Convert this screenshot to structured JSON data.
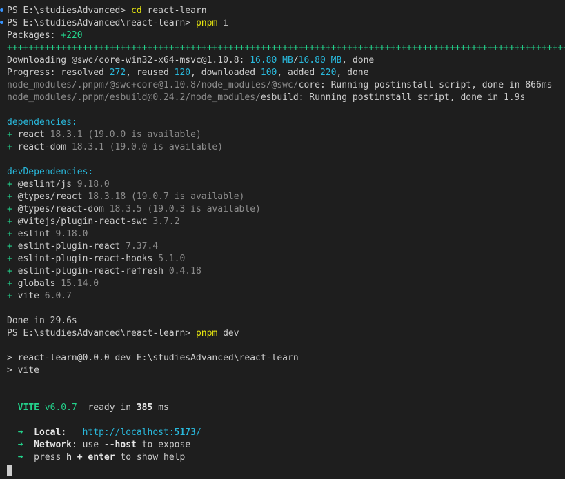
{
  "terminal": {
    "background": "#1e1e1e",
    "colors": {
      "default": "#cccccc",
      "command": "#e5e510",
      "info": "#29b8db",
      "success": "#23d18b",
      "dim": "#8d8d8d",
      "command_decoration": "#3794ff"
    },
    "lines": [
      [
        {
          "t": "PS E:\\studiesAdvanced> ",
          "c": "default"
        },
        {
          "t": "cd",
          "c": "yellow"
        },
        {
          "t": " react-learn",
          "c": "default"
        }
      ],
      [
        {
          "t": "PS E:\\studiesAdvanced\\react-learn> ",
          "c": "default"
        },
        {
          "t": "pnpm",
          "c": "yellow"
        },
        {
          "t": " i",
          "c": "default"
        }
      ],
      [
        {
          "t": "Packages: ",
          "c": "default"
        },
        {
          "t": "+220",
          "c": "green"
        }
      ],
      [
        {
          "t": "++++++++++++++++++++++++++++++++++++++++++++++++++++++++++++++++++++++++++++++++++++++++++++++++++++++++",
          "c": "green"
        }
      ],
      [
        {
          "t": "Downloading @swc/core-win32-x64-msvc@1.10.8: ",
          "c": "default"
        },
        {
          "t": "16.80 MB",
          "c": "cyan"
        },
        {
          "t": "/",
          "c": "default"
        },
        {
          "t": "16.80 MB",
          "c": "cyan"
        },
        {
          "t": ", done",
          "c": "default"
        }
      ],
      [
        {
          "t": "Progress: resolved ",
          "c": "default"
        },
        {
          "t": "272",
          "c": "cyan"
        },
        {
          "t": ", reused ",
          "c": "default"
        },
        {
          "t": "120",
          "c": "cyan"
        },
        {
          "t": ", downloaded ",
          "c": "default"
        },
        {
          "t": "100",
          "c": "cyan"
        },
        {
          "t": ", added ",
          "c": "default"
        },
        {
          "t": "220",
          "c": "cyan"
        },
        {
          "t": ", done",
          "c": "default"
        }
      ],
      [
        {
          "t": "node_modules/.pnpm/@swc+core@1.10.8/node_modules/@swc/",
          "c": "gray"
        },
        {
          "t": "core: Running postinstall script, done in 866ms",
          "c": "default"
        }
      ],
      [
        {
          "t": "node_modules/.pnpm/esbuild@0.24.2/node_modules/",
          "c": "gray"
        },
        {
          "t": "esbuild: Running postinstall script, done in 1.9s",
          "c": "default"
        }
      ],
      [],
      [
        {
          "t": "dependencies:",
          "c": "cyan"
        }
      ],
      [
        {
          "t": "+ ",
          "c": "green"
        },
        {
          "t": "react ",
          "c": "default"
        },
        {
          "t": "18.3.1 (19.0.0 is available)",
          "c": "gray"
        }
      ],
      [
        {
          "t": "+ ",
          "c": "green"
        },
        {
          "t": "react-dom ",
          "c": "default"
        },
        {
          "t": "18.3.1 (19.0.0 is available)",
          "c": "gray"
        }
      ],
      [],
      [
        {
          "t": "devDependencies:",
          "c": "cyan"
        }
      ],
      [
        {
          "t": "+ ",
          "c": "green"
        },
        {
          "t": "@eslint/js ",
          "c": "default"
        },
        {
          "t": "9.18.0",
          "c": "gray"
        }
      ],
      [
        {
          "t": "+ ",
          "c": "green"
        },
        {
          "t": "@types/react ",
          "c": "default"
        },
        {
          "t": "18.3.18 (19.0.7 is available)",
          "c": "gray"
        }
      ],
      [
        {
          "t": "+ ",
          "c": "green"
        },
        {
          "t": "@types/react-dom ",
          "c": "default"
        },
        {
          "t": "18.3.5 (19.0.3 is available)",
          "c": "gray"
        }
      ],
      [
        {
          "t": "+ ",
          "c": "green"
        },
        {
          "t": "@vitejs/plugin-react-swc ",
          "c": "default"
        },
        {
          "t": "3.7.2",
          "c": "gray"
        }
      ],
      [
        {
          "t": "+ ",
          "c": "green"
        },
        {
          "t": "eslint ",
          "c": "default"
        },
        {
          "t": "9.18.0",
          "c": "gray"
        }
      ],
      [
        {
          "t": "+ ",
          "c": "green"
        },
        {
          "t": "eslint-plugin-react ",
          "c": "default"
        },
        {
          "t": "7.37.4",
          "c": "gray"
        }
      ],
      [
        {
          "t": "+ ",
          "c": "green"
        },
        {
          "t": "eslint-plugin-react-hooks ",
          "c": "default"
        },
        {
          "t": "5.1.0",
          "c": "gray"
        }
      ],
      [
        {
          "t": "+ ",
          "c": "green"
        },
        {
          "t": "eslint-plugin-react-refresh ",
          "c": "default"
        },
        {
          "t": "0.4.18",
          "c": "gray"
        }
      ],
      [
        {
          "t": "+ ",
          "c": "green"
        },
        {
          "t": "globals ",
          "c": "default"
        },
        {
          "t": "15.14.0",
          "c": "gray"
        }
      ],
      [
        {
          "t": "+ ",
          "c": "green"
        },
        {
          "t": "vite ",
          "c": "default"
        },
        {
          "t": "6.0.7",
          "c": "gray"
        }
      ],
      [],
      [
        {
          "t": "Done in 29.6s",
          "c": "default"
        }
      ],
      [
        {
          "t": "PS E:\\studiesAdvanced\\react-learn> ",
          "c": "default"
        },
        {
          "t": "pnpm",
          "c": "yellow"
        },
        {
          "t": " dev",
          "c": "default"
        }
      ],
      [],
      [
        {
          "t": "> react-learn@0.0.0 dev E:\\studiesAdvanced\\react-learn",
          "c": "default"
        }
      ],
      [
        {
          "t": "> vite",
          "c": "default"
        }
      ],
      [],
      [],
      [
        {
          "t": "  ",
          "c": "default"
        },
        {
          "t": "VITE",
          "c": "green",
          "b": true
        },
        {
          "t": " v6.0.7",
          "c": "green"
        },
        {
          "t": "  ready in ",
          "c": "default"
        },
        {
          "t": "385",
          "c": "boldwhite"
        },
        {
          "t": " ms",
          "c": "default"
        }
      ],
      [],
      [
        {
          "t": "  ",
          "c": "default"
        },
        {
          "t": "➜",
          "c": "green"
        },
        {
          "t": "  ",
          "c": "default"
        },
        {
          "t": "Local:",
          "c": "boldwhite"
        },
        {
          "t": "   ",
          "c": "default"
        },
        {
          "t": "http://localhost:",
          "c": "cyan"
        },
        {
          "t": "5173",
          "c": "cyan",
          "b": true
        },
        {
          "t": "/",
          "c": "cyan"
        }
      ],
      [
        {
          "t": "  ",
          "c": "default"
        },
        {
          "t": "➜",
          "c": "green"
        },
        {
          "t": "  ",
          "c": "default"
        },
        {
          "t": "Network",
          "c": "boldwhite"
        },
        {
          "t": ": use ",
          "c": "default"
        },
        {
          "t": "--host",
          "c": "boldwhite"
        },
        {
          "t": " to expose",
          "c": "default"
        }
      ],
      [
        {
          "t": "  ",
          "c": "default"
        },
        {
          "t": "➜",
          "c": "green"
        },
        {
          "t": "  press ",
          "c": "default"
        },
        {
          "t": "h + enter",
          "c": "boldwhite"
        },
        {
          "t": " to show help",
          "c": "default"
        }
      ]
    ],
    "command_decoration_lines": [
      0,
      1
    ]
  }
}
